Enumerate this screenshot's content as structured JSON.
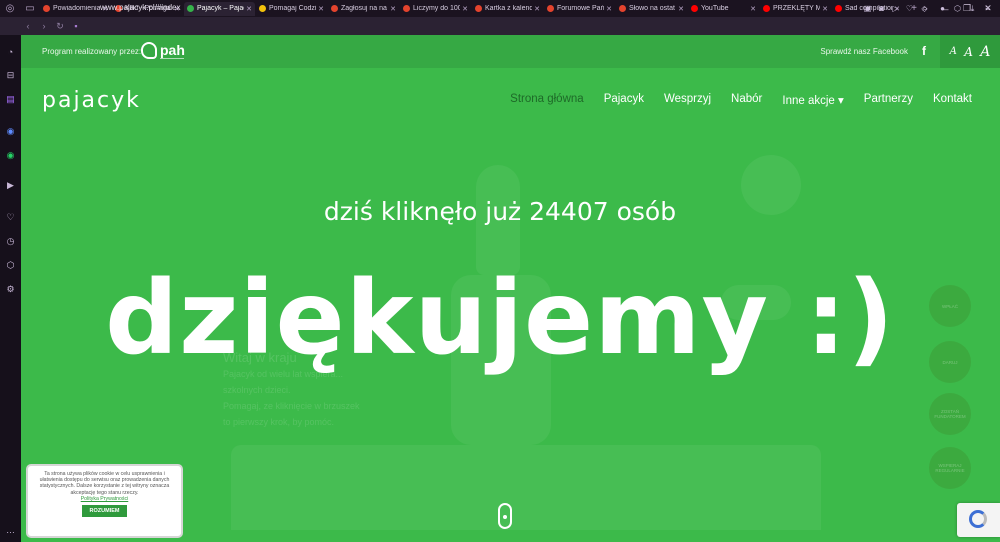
{
  "browser": {
    "tabs": [
      {
        "title": "Powiadomienia",
        "favicon_color": "#e4432d",
        "active": false
      },
      {
        "title": "Klik! - Pomaga",
        "favicon_color": "#e4432d",
        "active": false
      },
      {
        "title": "Pajacyk – Pajacy",
        "favicon_color": "#35b34a",
        "active": true
      },
      {
        "title": "Pomagaj Codzie",
        "favicon_color": "#f2c10b",
        "active": false
      },
      {
        "title": "Zagłosuj na na",
        "favicon_color": "#e4432d",
        "active": false
      },
      {
        "title": "Liczymy do 100",
        "favicon_color": "#e4432d",
        "active": false
      },
      {
        "title": "Kartka z kalend",
        "favicon_color": "#e4432d",
        "active": false
      },
      {
        "title": "Forumowe Pań",
        "favicon_color": "#e4432d",
        "active": false
      },
      {
        "title": "Słowo na ostat",
        "favicon_color": "#e4432d",
        "active": false
      },
      {
        "title": "YouTube",
        "favicon_color": "#ff0000",
        "active": false
      },
      {
        "title": "PRZEKLĘTY MĘ",
        "favicon_color": "#ff0000",
        "active": false
      },
      {
        "title": "Sad compilation",
        "favicon_color": "#ff0000",
        "active": false
      }
    ],
    "new_tab": "+",
    "url": "www.pajacyk.pl/#index"
  },
  "header": {
    "program_label": "Program realizowany przez:",
    "pah_logo": "pah",
    "facebook_label": "Sprawdź nasz Facebook",
    "facebook_icon": "f",
    "font_sizes": [
      "A",
      "A",
      "A"
    ]
  },
  "site": {
    "logo": "pajacyk",
    "nav": [
      {
        "label": "Strona główna",
        "active": true
      },
      {
        "label": "Pajacyk",
        "active": false
      },
      {
        "label": "Wesprzyj",
        "active": false
      },
      {
        "label": "Nabór",
        "active": false
      },
      {
        "label": "Inne akcje ▾",
        "active": false
      },
      {
        "label": "Partnerzy",
        "active": false
      },
      {
        "label": "Kontakt",
        "active": false
      }
    ]
  },
  "hero": {
    "counter_text": "dziś kliknęło już 24407 osób",
    "thanks_text": "dziękujemy :)"
  },
  "background_text": {
    "heading": "Witaj w kraju",
    "lines": [
      "Pajacyk od wielu lat wspiera...",
      "szkolnych dzieci.",
      "Pomagaj, ze kliknięcie w brzuszek",
      "to pierwszy krok, by pomóc."
    ]
  },
  "side_buttons": [
    "WPŁAĆ",
    "DARUJ",
    "ZOSTAŃ FUNDATOREM",
    "WSPIERAJ REGULARNIE"
  ],
  "cookie": {
    "text": "Ta strona używa plików cookie w celu usprawnienia i ułatwienia dostępu do serwisu oraz prowadzenia danych statystycznych. Dalsze korzystanie z tej witryny oznacza akceptację tego stanu rzeczy.",
    "link": "Polityka Prywatności",
    "button": "ROZUMIEM"
  },
  "colors": {
    "page_green": "#3cba4a",
    "active_nav": "#1e6a28",
    "browser_bg": "#1b1320"
  }
}
